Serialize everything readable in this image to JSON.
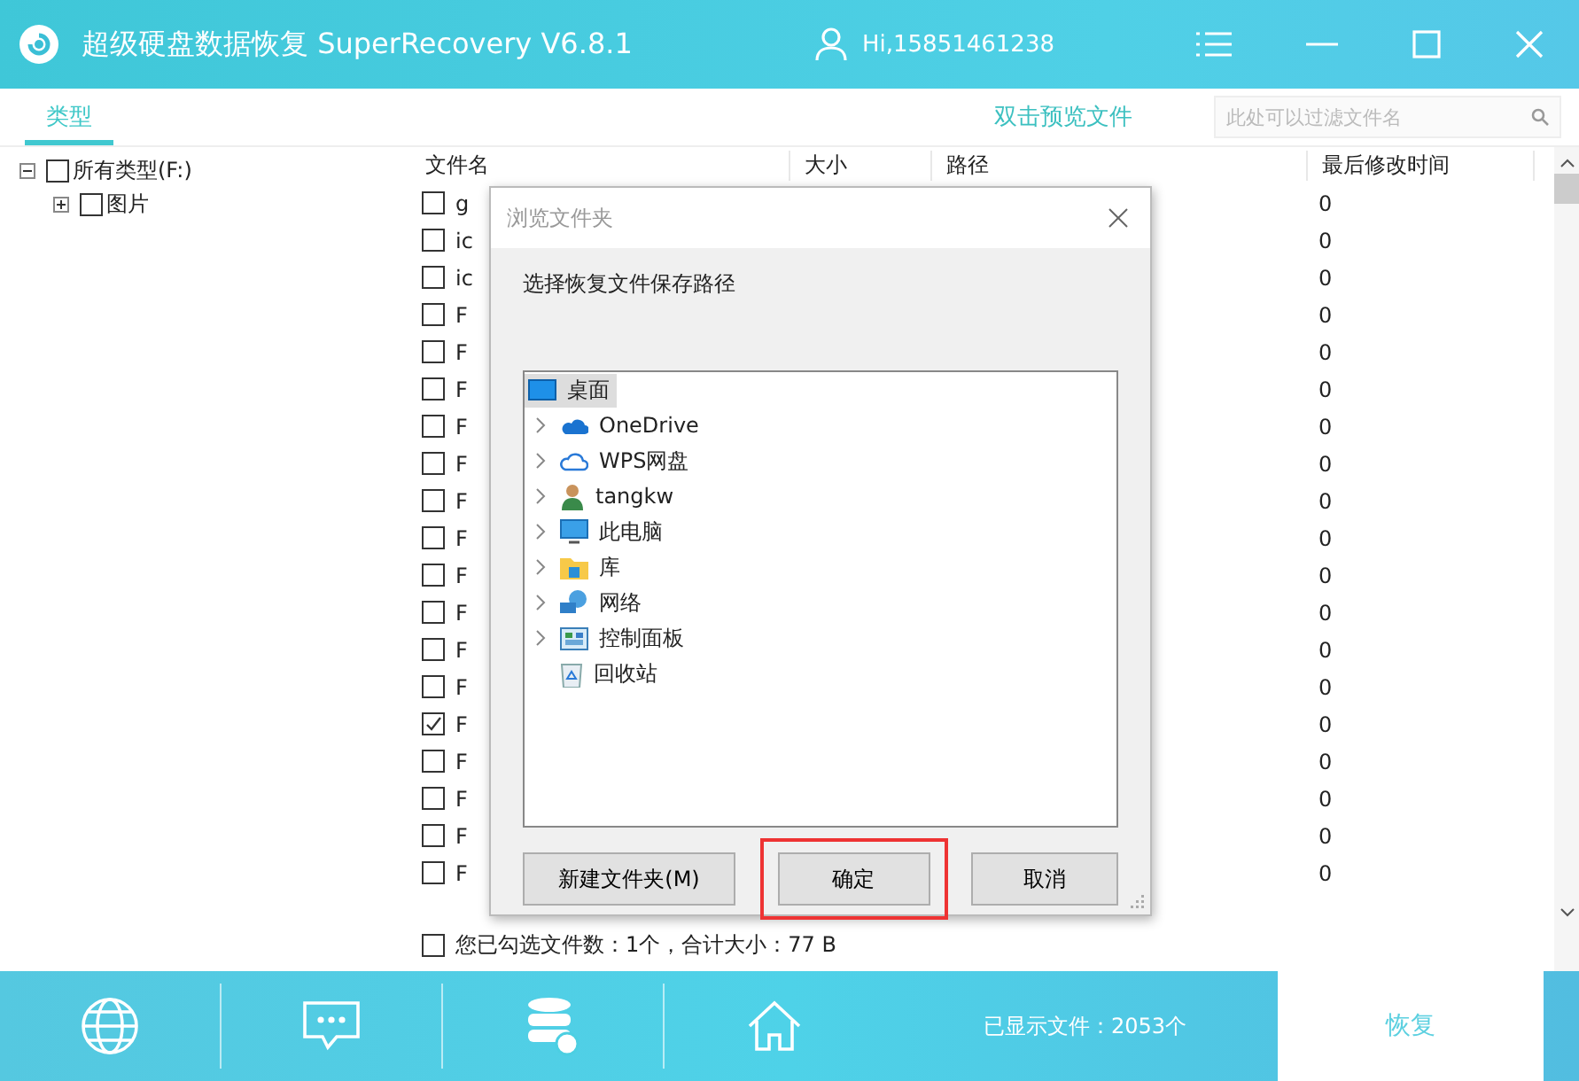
{
  "window": {
    "title": "超级硬盘数据恢复 SuperRecovery V6.8.1",
    "user": "Hi,15851461238"
  },
  "toolbar": {
    "tabs": [
      {
        "label": "类型",
        "selected": true
      }
    ],
    "preview_link": "双击预览文件",
    "search": {
      "placeholder": "此处可以过滤文件名"
    }
  },
  "type_tree": [
    {
      "label": "所有类型(F:)",
      "checked": false,
      "expanded": true,
      "children": [
        {
          "label": "图片",
          "checked": false,
          "expanded": false
        }
      ]
    }
  ],
  "table": {
    "columns": [
      "文件名",
      "大小",
      "路径",
      "最后修改时间"
    ],
    "rows": [
      {
        "name": "g",
        "checked": false,
        "modified": "0"
      },
      {
        "name": "ic",
        "checked": false,
        "modified": "0"
      },
      {
        "name": "ic",
        "checked": false,
        "modified": "0"
      },
      {
        "name": "F",
        "checked": false,
        "modified": "0"
      },
      {
        "name": "F",
        "checked": false,
        "modified": "0"
      },
      {
        "name": "F",
        "checked": false,
        "modified": "0"
      },
      {
        "name": "F",
        "checked": false,
        "modified": "0"
      },
      {
        "name": "F",
        "checked": false,
        "modified": "0"
      },
      {
        "name": "F",
        "checked": false,
        "modified": "0"
      },
      {
        "name": "F",
        "checked": false,
        "modified": "0"
      },
      {
        "name": "F",
        "checked": false,
        "modified": "0"
      },
      {
        "name": "F",
        "checked": false,
        "modified": "0"
      },
      {
        "name": "F",
        "checked": false,
        "modified": "0"
      },
      {
        "name": "F",
        "checked": false,
        "modified": "0"
      },
      {
        "name": "F",
        "checked": true,
        "modified": "0"
      },
      {
        "name": "F",
        "checked": false,
        "modified": "0"
      },
      {
        "name": "F",
        "checked": false,
        "modified": "0"
      },
      {
        "name": "F",
        "checked": false,
        "modified": "0"
      },
      {
        "name": "F",
        "checked": false,
        "modified": "0"
      }
    ],
    "status": "您已勾选文件数：1个，合计大小：77 B",
    "status_checked": false
  },
  "dialog": {
    "title": "浏览文件夹",
    "instruction": "选择恢复文件保存路径",
    "folders": [
      {
        "label": "桌面",
        "selected": true,
        "expandable": false
      },
      {
        "label": "OneDrive",
        "selected": false,
        "expandable": true
      },
      {
        "label": "WPS网盘",
        "selected": false,
        "expandable": true
      },
      {
        "label": "tangkw",
        "selected": false,
        "expandable": true
      },
      {
        "label": "此电脑",
        "selected": false,
        "expandable": true
      },
      {
        "label": "库",
        "selected": false,
        "expandable": true
      },
      {
        "label": "网络",
        "selected": false,
        "expandable": true
      },
      {
        "label": "控制面板",
        "selected": false,
        "expandable": true
      },
      {
        "label": "回收站",
        "selected": false,
        "expandable": false
      }
    ],
    "buttons": [
      {
        "label": "新建文件夹(M)",
        "highlighted": false
      },
      {
        "label": "确定",
        "highlighted": true
      },
      {
        "label": "取消",
        "highlighted": false
      }
    ]
  },
  "footer": {
    "shown_count": "已显示文件：2053个",
    "recover_button": "恢复"
  }
}
